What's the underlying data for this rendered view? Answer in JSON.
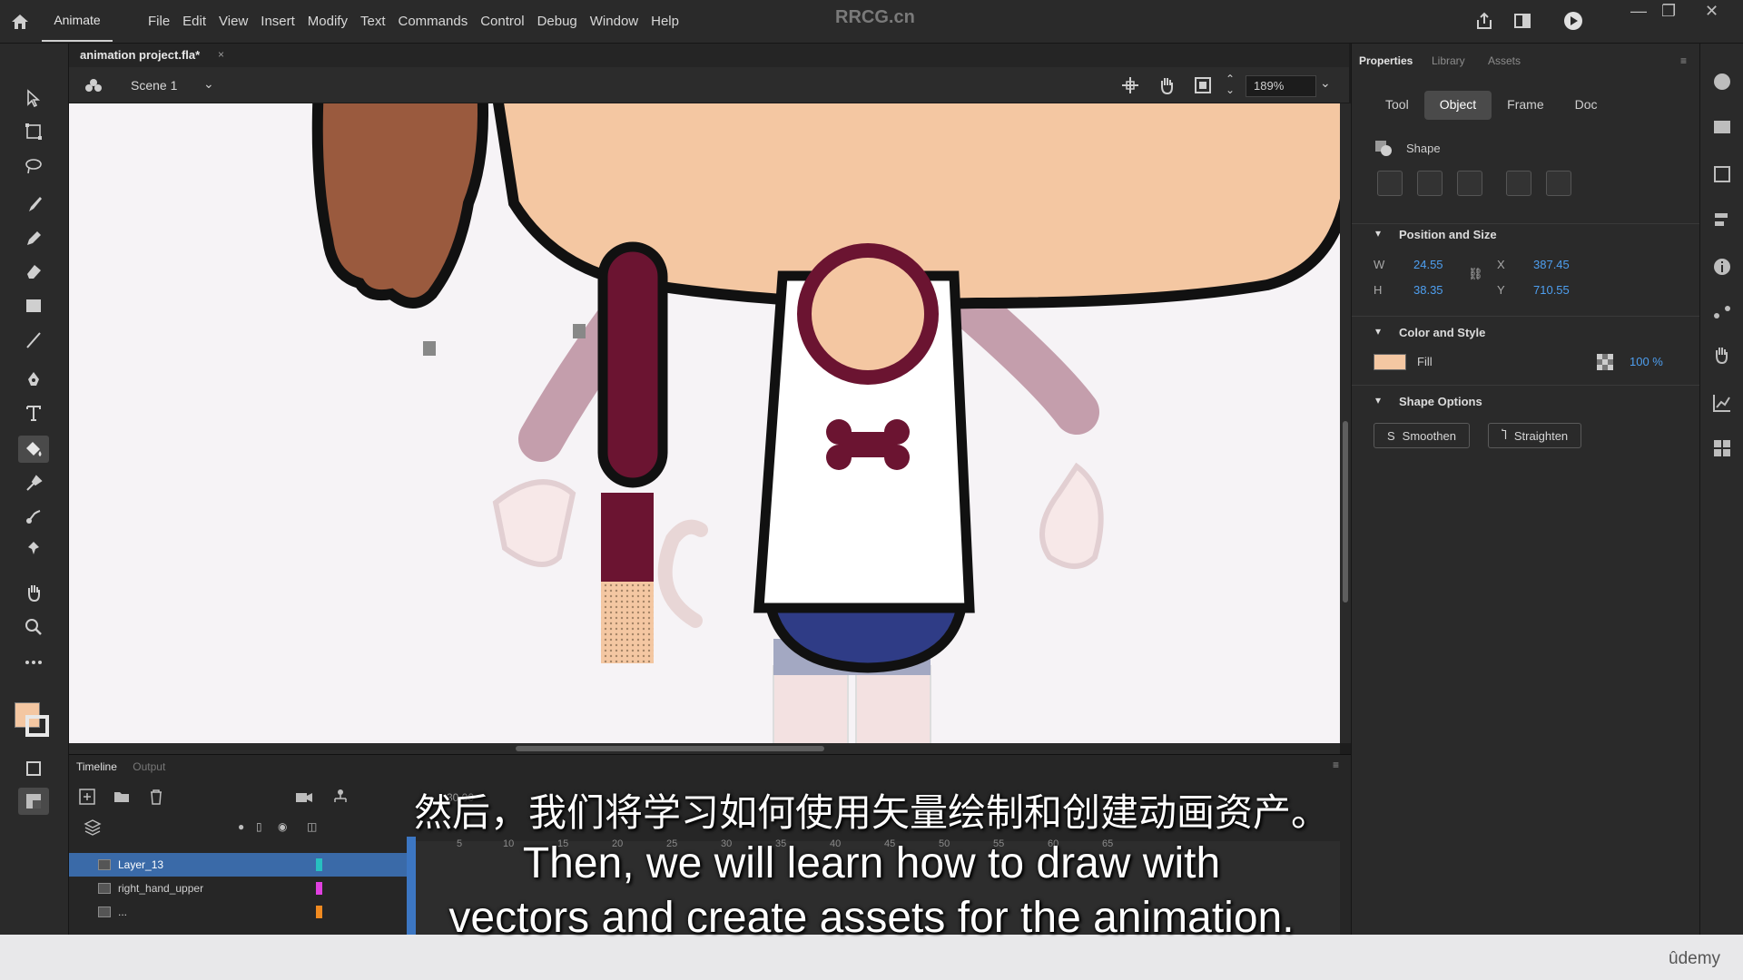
{
  "menubar": {
    "app_name": "Animate",
    "items": [
      "File",
      "Edit",
      "View",
      "Insert",
      "Modify",
      "Text",
      "Commands",
      "Control",
      "Debug",
      "Window",
      "Help"
    ],
    "watermark": "RRCG.cn"
  },
  "document": {
    "tab_title": "animation project.fla*",
    "scene": "Scene 1",
    "zoom": "189%"
  },
  "timeline": {
    "tabs": [
      "Timeline",
      "Output"
    ],
    "fps": "30.00",
    "layers": [
      "Layer_13",
      "right_hand_upper",
      "..."
    ],
    "ruler": [
      "5",
      "10",
      "15",
      "20",
      "25",
      "30",
      "35",
      "40",
      "45",
      "50",
      "55",
      "60",
      "65"
    ]
  },
  "properties": {
    "tabs": [
      "Properties",
      "Library",
      "Assets"
    ],
    "subtabs": [
      "Tool",
      "Object",
      "Frame",
      "Doc"
    ],
    "selection_type": "Shape",
    "position_and_size": {
      "title": "Position and Size",
      "w_label": "W",
      "w": "24.55",
      "h_label": "H",
      "h": "38.35",
      "x_label": "X",
      "x": "387.45",
      "y_label": "Y",
      "y": "710.55"
    },
    "color_and_style": {
      "title": "Color and Style",
      "fill_label": "Fill",
      "fill_color": "#f4c7a2",
      "alpha": "100 %"
    },
    "shape_options": {
      "title": "Shape Options",
      "smoothen": "Smoothen",
      "straighten": "Straighten"
    }
  },
  "subtitles": {
    "chinese": "然后，我们将学习如何使用矢量绘制和创建动画资产。",
    "english_line1": "Then, we will learn how to draw with",
    "english_line2": "vectors and create assets for the animation."
  },
  "branding": {
    "udemy": "ûdemy"
  }
}
